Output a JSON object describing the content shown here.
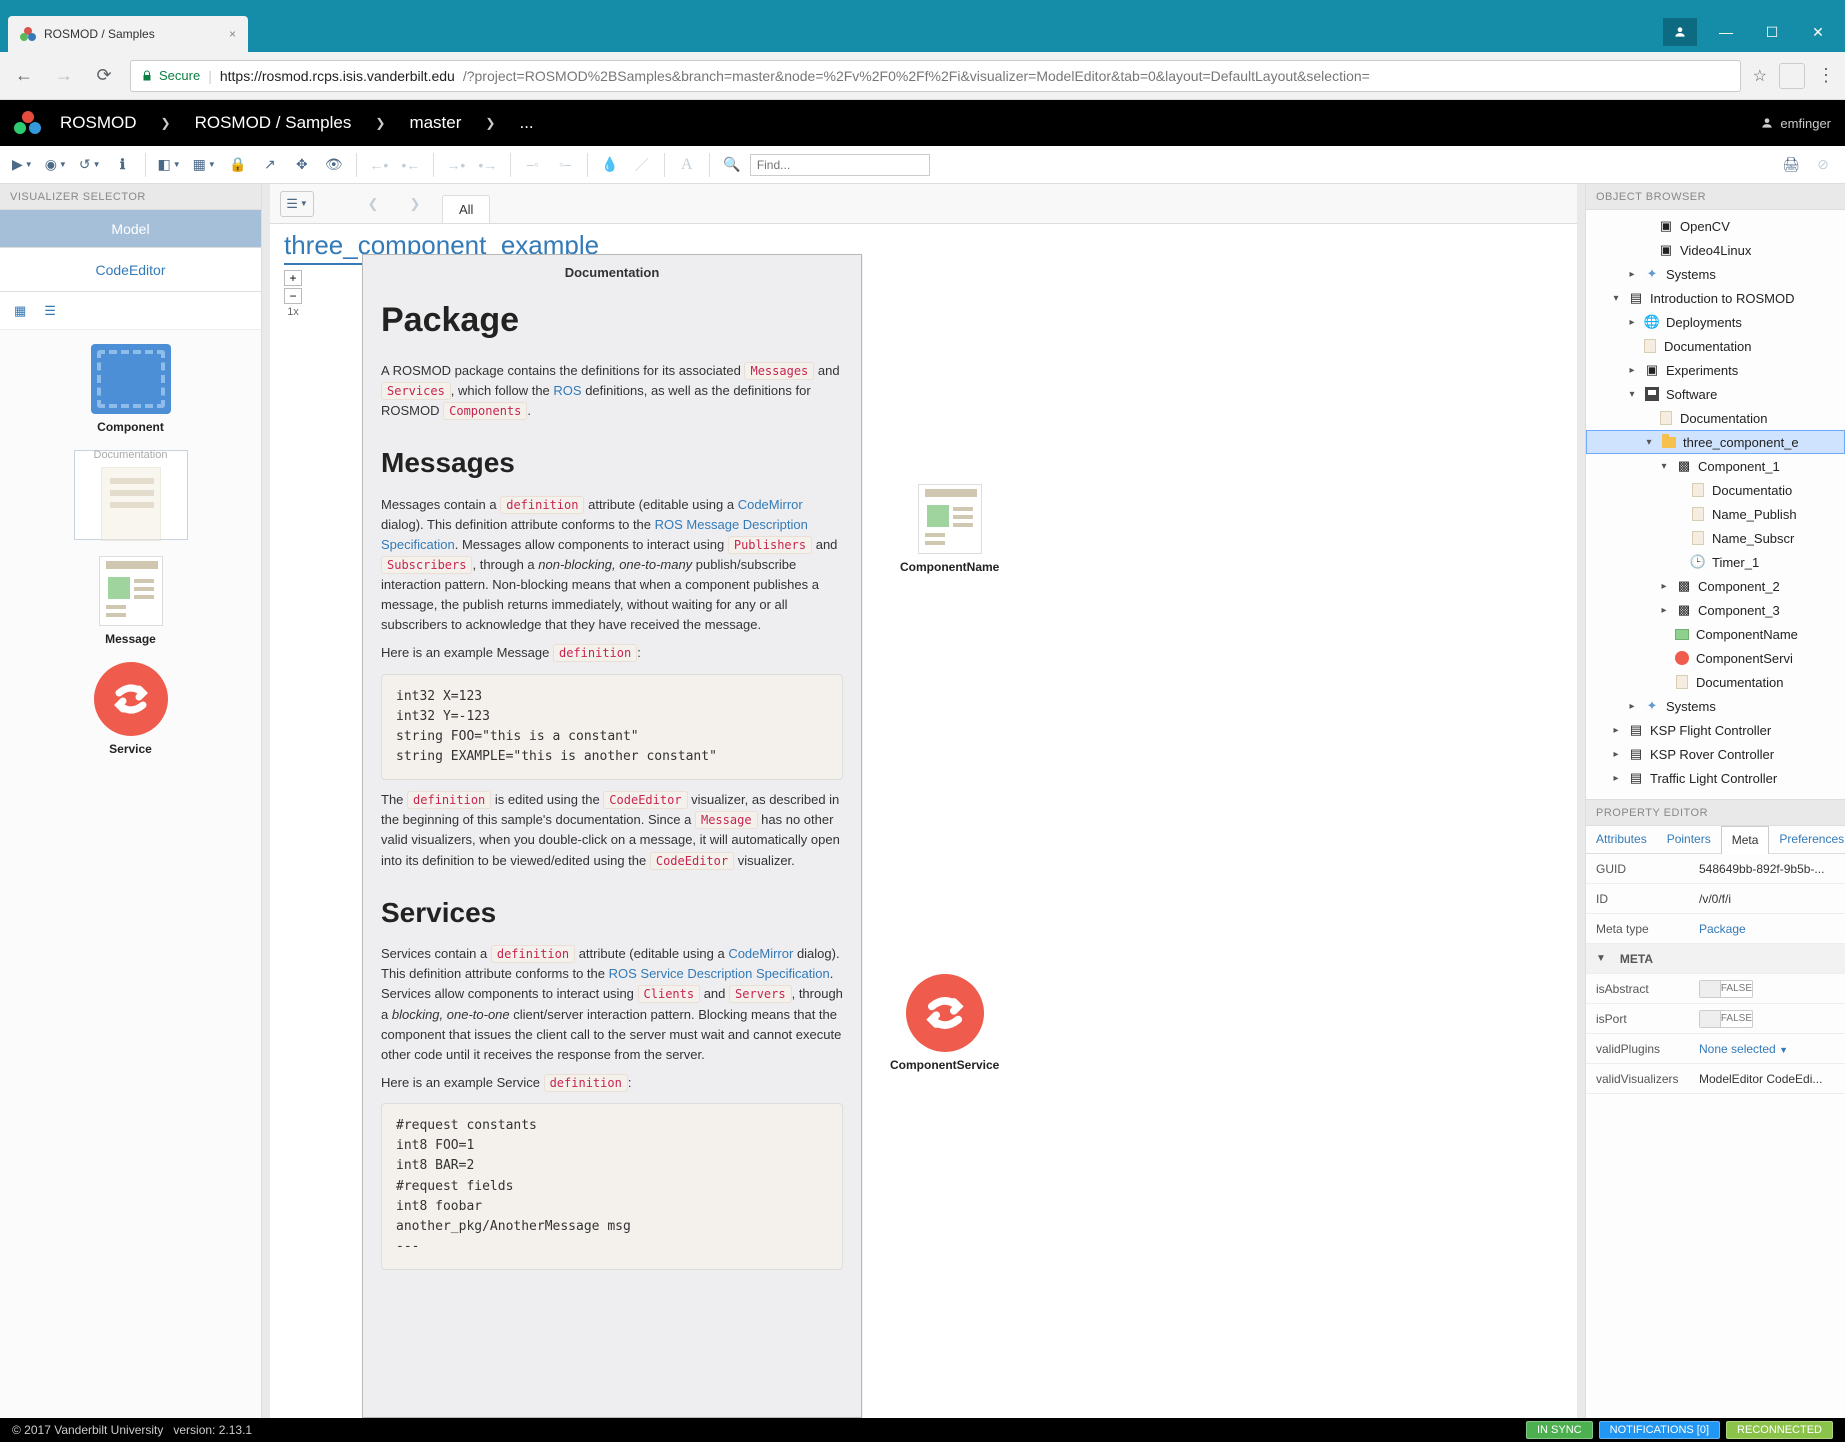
{
  "browser": {
    "tab_title": "ROSMOD / Samples",
    "secure_label": "Secure",
    "url_host": "https://rosmod.rcps.isis.vanderbilt.edu",
    "url_path": "/?project=ROSMOD%2BSamples&branch=master&node=%2Fv%2F0%2Ff%2Fi&visualizer=ModelEditor&tab=0&layout=DefaultLayout&selection="
  },
  "header": {
    "app": "ROSMOD",
    "crumb1": "ROSMOD / Samples",
    "crumb2": "master",
    "crumb3": "...",
    "user": "emfinger"
  },
  "toolbar": {
    "find_placeholder": "Find..."
  },
  "left": {
    "selector_title": "VISUALIZER SELECTOR",
    "model": "Model",
    "code": "CodeEditor",
    "palette": {
      "component": "Component",
      "documentation": "Documentation",
      "message": "Message",
      "service": "Service"
    }
  },
  "canvas": {
    "title": "three_component_example",
    "zoom": "1x",
    "breadcrumb_tab": "All",
    "node_component_name": "ComponentName",
    "node_component_service": "ComponentService"
  },
  "doc": {
    "panel_title": "Documentation",
    "h1": "Package",
    "p1a": "A ROSMOD package contains the definitions for its associated ",
    "k_messages": "Messages",
    "and1": " and ",
    "k_services": "Services",
    "p1b": ", which follow the ",
    "ros": "ROS",
    "p1c": " definitions, as well as the definitions for ROSMOD ",
    "k_components": "Components",
    "h2_msg": "Messages",
    "p2a": "Messages contain a ",
    "k_def": "definition",
    "p2b": " attribute (editable using a ",
    "codemirror": "CodeMirror",
    "p2c": " dialog). This definition attribute conforms to the ",
    "ros_msg_spec": "ROS Message Description Specification",
    "p2d": ". Messages allow components to interact using ",
    "k_pub": "Publishers",
    "and2": " and ",
    "k_sub": "Subscribers",
    "p2e": ", through a ",
    "nb": "non-blocking, one-to-many",
    "p2f": " publish/subscribe interaction pattern. Non-blocking means that when a component publishes a message, the publish returns immediately, without waiting for any or all subscribers to acknowledge that they have received the message.",
    "p3a": "Here is an example Message ",
    "k_def2": "definition",
    "code1": "int32 X=123\nint32 Y=-123\nstring FOO=\"this is a constant\"\nstring EXAMPLE=\"this is another constant\"",
    "p4a": "The ",
    "k_def3": "definition",
    "p4b": " is edited using the ",
    "k_ce": "CodeEditor",
    "p4c": " visualizer, as described in the beginning of this sample's documentation. Since a ",
    "k_msg": "Message",
    "p4d": " has no other valid visualizers, when you double-click on a message, it will automatically open into its definition to be viewed/edited using the ",
    "k_ce2": "CodeEditor",
    "p4e": " visualizer.",
    "h2_svc": "Services",
    "p5a": "Services contain a ",
    "k_def4": "definition",
    "p5b": " attribute (editable using a ",
    "codemirror2": "CodeMirror",
    "p5c": " dialog). This definition attribute conforms to the ",
    "ros_svc_spec": "ROS Service Description Specification",
    "p5d": ". Services allow components to interact using ",
    "k_cli": "Clients",
    "and3": " and ",
    "k_srv": "Servers",
    "p5e": ", through a ",
    "blk": "blocking, one-to-one",
    "p5f": " client/server interaction pattern. Blocking means that the component that issues the client call to the server must wait and cannot execute other code until it receives the response from the server.",
    "p6a": "Here is an example Service ",
    "k_def5": "definition",
    "code2": "#request constants\nint8 FOO=1\nint8 BAR=2\n#request fields\nint8 foobar\nanother_pkg/AnotherMessage msg\n---"
  },
  "right": {
    "ob_title": "OBJECT BROWSER",
    "pe_title": "PROPERTY EDITOR",
    "tabs": {
      "attributes": "Attributes",
      "pointers": "Pointers",
      "meta": "Meta",
      "preferences": "Preferences"
    },
    "rows": {
      "guid_k": "GUID",
      "guid_v": "548649bb-892f-9b5b-...",
      "id_k": "ID",
      "id_v": "/v/0/f/i",
      "mt_k": "Meta type",
      "mt_v": "Package",
      "meta_sect": "META",
      "abs_k": "isAbstract",
      "abs_v": "FALSE",
      "port_k": "isPort",
      "port_v": "FALSE",
      "vp_k": "validPlugins",
      "vp_v": "None selected",
      "vv_k": "validVisualizers",
      "vv_v": "ModelEditor CodeEdi..."
    },
    "tree": {
      "opencv": "OpenCV",
      "v4l": "Video4Linux",
      "systems": "Systems",
      "intro": "Introduction to ROSMOD",
      "deploy": "Deployments",
      "doc": "Documentation",
      "exp": "Experiments",
      "sw": "Software",
      "doc2": "Documentation",
      "tce": "three_component_e",
      "c1": "Component_1",
      "doc3": "Documentatio",
      "np": "Name_Publish",
      "ns": "Name_Subscr",
      "t1": "Timer_1",
      "c2": "Component_2",
      "c3": "Component_3",
      "cname": "ComponentName",
      "cserv": "ComponentServi",
      "doc4": "Documentation",
      "sys2": "Systems",
      "ksp1": "KSP Flight Controller",
      "ksp2": "KSP Rover Controller",
      "tlc": "Traffic Light Controller"
    }
  },
  "footer": {
    "copyright": "© 2017 Vanderbilt University",
    "version_label": "version:",
    "version": "2.13.1",
    "insync": "IN SYNC",
    "notif": "NOTIFICATIONS [0]",
    "reconn": "RECONNECTED"
  }
}
